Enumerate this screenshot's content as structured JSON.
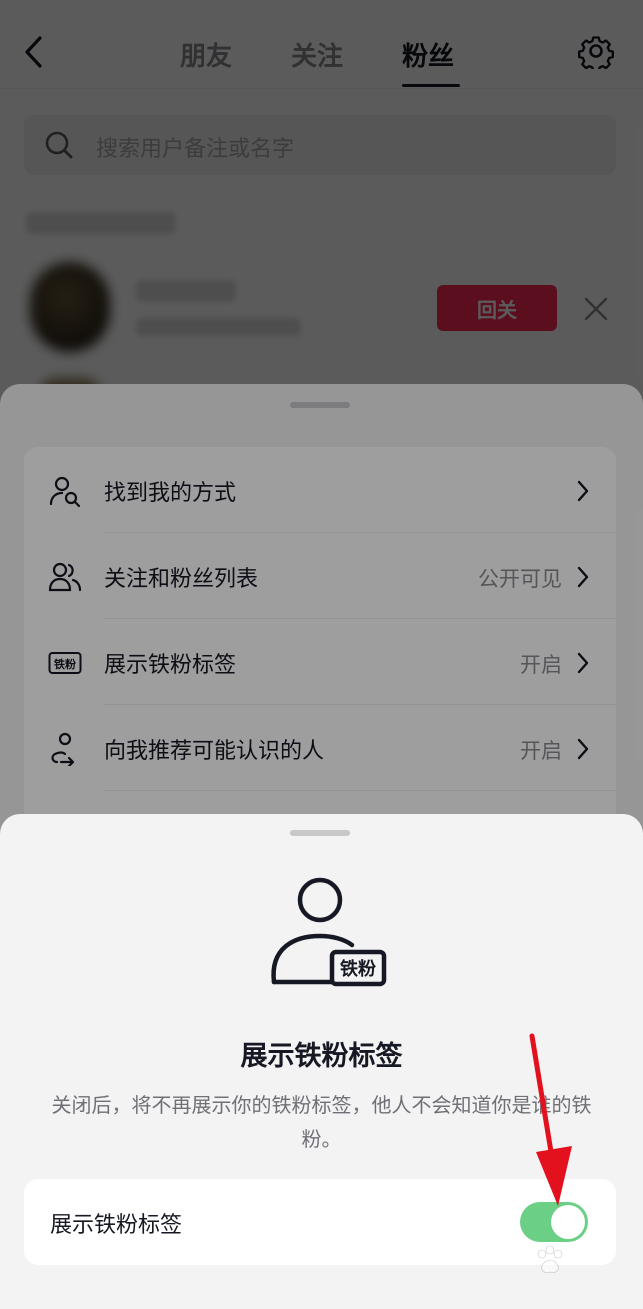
{
  "header": {
    "tabs": [
      {
        "label": "朋友"
      },
      {
        "label": "关注"
      },
      {
        "label": "粉丝"
      }
    ],
    "active_tab": "粉丝"
  },
  "search": {
    "placeholder": "搜索用户备注或名字"
  },
  "follower_row": {
    "follow_back_label": "回关"
  },
  "privacy_menu": {
    "items": [
      {
        "label": "找到我的方式",
        "value": "",
        "icon": "find-user-icon"
      },
      {
        "label": "关注和粉丝列表",
        "value": "公开可见",
        "icon": "users-icon"
      },
      {
        "label": "展示铁粉标签",
        "value": "开启",
        "icon": "tiefen-badge-icon"
      },
      {
        "label": "向我推荐可能认识的人",
        "value": "开启",
        "icon": "recommend-icon"
      }
    ]
  },
  "tiefen_sheet": {
    "badge_text": "铁粉",
    "title": "展示铁粉标签",
    "description": "关闭后，将不再展示你的铁粉标签，他人不会知道你是谁的铁粉。",
    "toggle_label": "展示铁粉标签",
    "toggle_on": true
  },
  "colors": {
    "accent_red": "#fe2c55",
    "toggle_green": "#6bcf86"
  }
}
